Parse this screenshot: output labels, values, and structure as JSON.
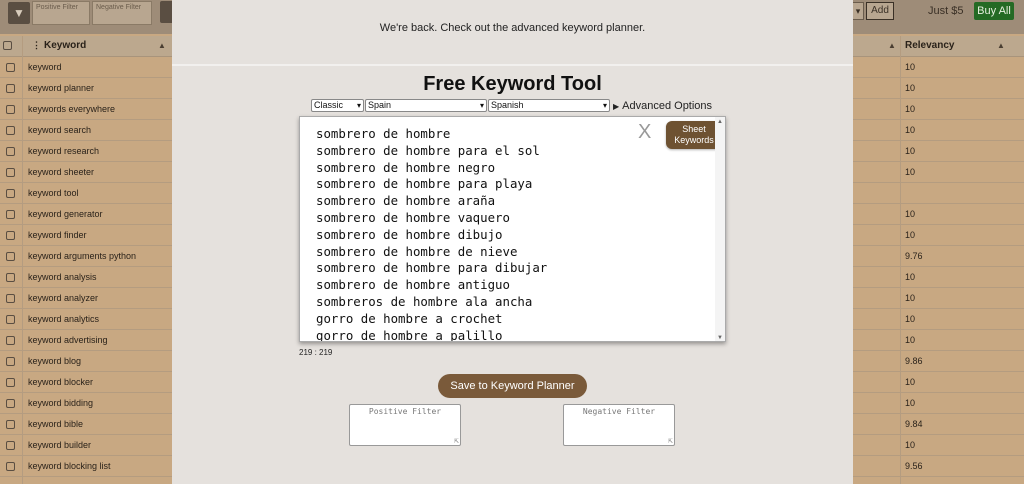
{
  "background": {
    "topbar": {
      "positive_filter_placeholder": "Positive Filter",
      "negative_filter_placeholder": "Negative Filter",
      "add_label": "Add",
      "price": "Just $5",
      "buy_all_label": "Buy All"
    },
    "table": {
      "col_keyword": "Keyword",
      "col_relevancy": "Relevancy",
      "rows": [
        {
          "keyword": "keyword",
          "relevancy": "10"
        },
        {
          "keyword": "keyword planner",
          "relevancy": "10"
        },
        {
          "keyword": "keywords everywhere",
          "relevancy": "10"
        },
        {
          "keyword": "keyword search",
          "relevancy": "10"
        },
        {
          "keyword": "keyword research",
          "relevancy": "10"
        },
        {
          "keyword": "keyword sheeter",
          "relevancy": "10"
        },
        {
          "keyword": "keyword tool",
          "relevancy": ""
        },
        {
          "keyword": "keyword generator",
          "relevancy": "10"
        },
        {
          "keyword": "keyword finder",
          "relevancy": "10"
        },
        {
          "keyword": "keyword arguments python",
          "relevancy": "9.76"
        },
        {
          "keyword": "keyword analysis",
          "relevancy": "10"
        },
        {
          "keyword": "keyword analyzer",
          "relevancy": "10"
        },
        {
          "keyword": "keyword analytics",
          "relevancy": "10"
        },
        {
          "keyword": "keyword advertising",
          "relevancy": "10"
        },
        {
          "keyword": "keyword blog",
          "relevancy": "9.86"
        },
        {
          "keyword": "keyword blocker",
          "relevancy": "10"
        },
        {
          "keyword": "keyword bidding",
          "relevancy": "10"
        },
        {
          "keyword": "keyword bible",
          "relevancy": "9.84"
        },
        {
          "keyword": "keyword builder",
          "relevancy": "10"
        },
        {
          "keyword": "keyword blocking list",
          "relevancy": "9.56"
        }
      ]
    }
  },
  "modal": {
    "banner": "We're back. Check out the advanced keyword planner.",
    "title": "Free Keyword Tool",
    "mode_select": "Classic",
    "country_select": "Spain",
    "language_select": "Spanish",
    "advanced_options": "Advanced Options",
    "close_label": "X",
    "sheet_keywords_line1": "Sheet",
    "sheet_keywords_line2": "Keywords",
    "keywords": [
      "sombrero de hombre",
      "sombrero de hombre para el sol",
      "sombrero de hombre negro",
      "sombrero de hombre para playa",
      "sombrero de hombre araña",
      "sombrero de hombre vaquero",
      "sombrero de hombre dibujo",
      "sombrero de hombre de nieve",
      "sombrero de hombre para dibujar",
      "sombrero de hombre antiguo",
      "sombreros de hombre ala ancha",
      "gorro de hombre a crochet",
      "gorro de hombre a palillo"
    ],
    "counter": "219 : 219",
    "save_label": "Save to Keyword Planner",
    "positive_filter_placeholder": "Positive Filter",
    "negative_filter_placeholder": "Negative Filter"
  }
}
